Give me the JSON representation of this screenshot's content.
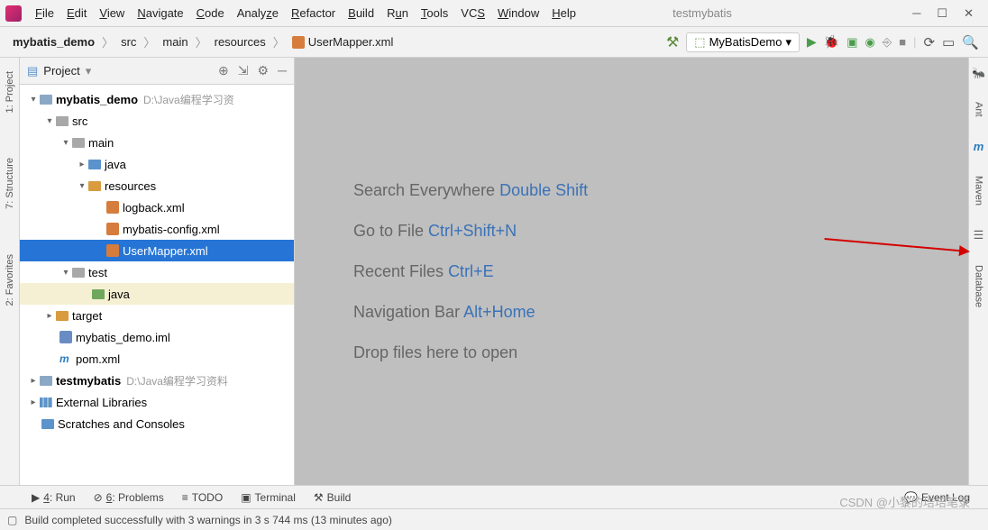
{
  "title": "testmybatis",
  "menu": [
    "File",
    "Edit",
    "View",
    "Navigate",
    "Code",
    "Analyze",
    "Refactor",
    "Build",
    "Run",
    "Tools",
    "VCS",
    "Window",
    "Help"
  ],
  "breadcrumb": {
    "root": "mybatis_demo",
    "parts": [
      "src",
      "main",
      "resources"
    ],
    "file": "UserMapper.xml"
  },
  "run_config": {
    "name": "MyBatisDemo"
  },
  "project_panel": {
    "title": "Project"
  },
  "tree": {
    "root": "mybatis_demo",
    "root_hint": "D:\\Java编程学习资",
    "src": "src",
    "main": "main",
    "java": "java",
    "resources": "resources",
    "files": {
      "logback": "logback.xml",
      "mybatis_config": "mybatis-config.xml",
      "user_mapper": "UserMapper.xml"
    },
    "test": "test",
    "test_java": "java",
    "target": "target",
    "iml": "mybatis_demo.iml",
    "pom": "pom.xml",
    "second_proj": "testmybatis",
    "second_proj_hint": "D:\\Java编程学习资料",
    "ext_lib": "External Libraries",
    "scratches": "Scratches and Consoles"
  },
  "welcome": {
    "search": {
      "label": "Search Everywhere",
      "shortcut": "Double Shift"
    },
    "goto": {
      "label": "Go to File",
      "shortcut": "Ctrl+Shift+N"
    },
    "recent": {
      "label": "Recent Files",
      "shortcut": "Ctrl+E"
    },
    "nav": {
      "label": "Navigation Bar",
      "shortcut": "Alt+Home"
    },
    "drop": {
      "label": "Drop files here to open"
    }
  },
  "left_gutter": {
    "project": "1: Project",
    "structure": "7: Structure",
    "favorites": "2: Favorites"
  },
  "right_gutter": {
    "ant": "Ant",
    "maven": "Maven",
    "database": "Database"
  },
  "bottom_tabs": {
    "run": "4: Run",
    "problems": "6: Problems",
    "todo": "TODO",
    "terminal": "Terminal",
    "build": "Build",
    "event_log": "Event Log"
  },
  "status": "Build completed successfully with 3 warnings in 3 s 744 ms (13 minutes ago)",
  "watermark": "CSDN @小黎的培培笔录"
}
